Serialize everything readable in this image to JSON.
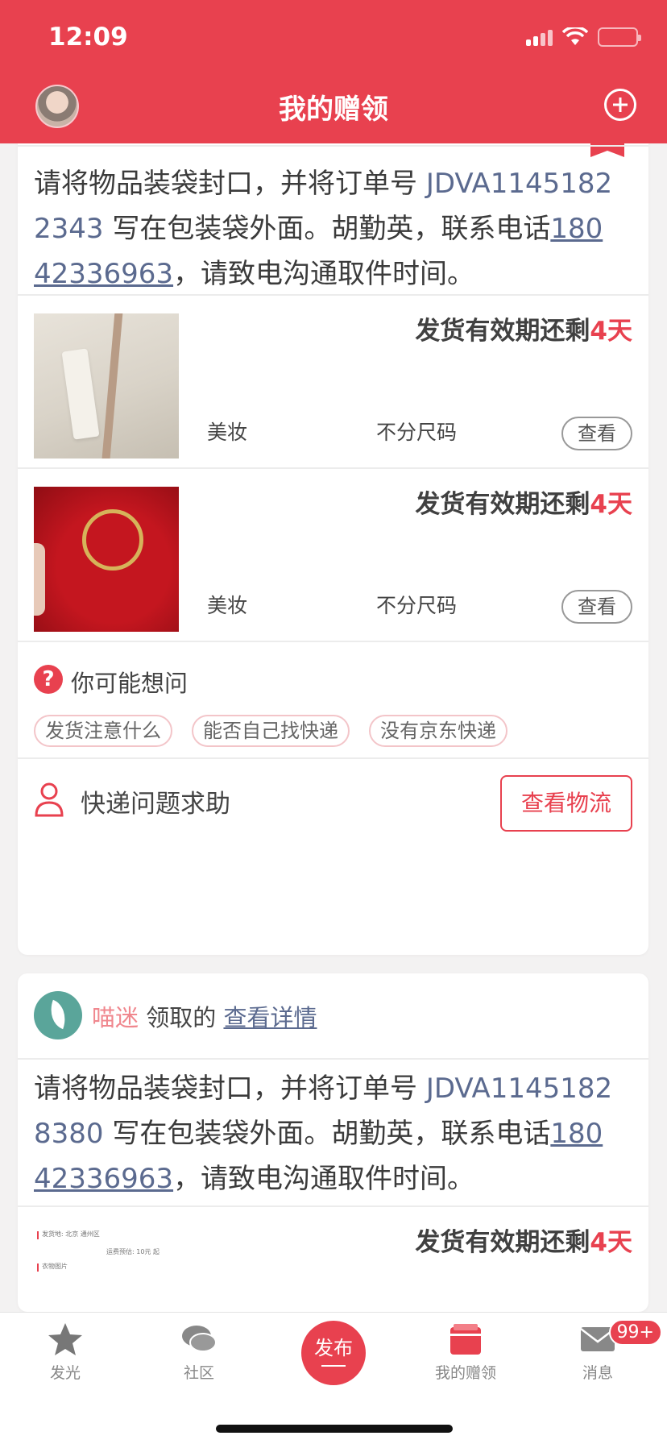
{
  "status_bar": {
    "time": "12:09"
  },
  "header": {
    "title": "我的赠领"
  },
  "card1": {
    "instruction": {
      "pre": "请将物品装袋封口，并将订单号 ",
      "order_line1": "JDVA1145182",
      "order_line2": "2343",
      "mid": " 写在包装袋外面。胡勤英，联系电话",
      "phone_line1": "180",
      "phone_line2": "42336963",
      "post": "，请致电沟通取件时间。"
    },
    "items": [
      {
        "deadline_prefix": "发货有效期还剩",
        "deadline_days": "4天",
        "category": "美妆",
        "size": "不分尺码",
        "view": "查看"
      },
      {
        "deadline_prefix": "发货有效期还剩",
        "deadline_days": "4天",
        "category": "美妆",
        "size": "不分尺码",
        "view": "查看"
      }
    ],
    "faq": {
      "title": "你可能想问",
      "chips": [
        "发货注意什么",
        "能否自己找快递",
        "没有京东快递"
      ]
    },
    "help": {
      "text": "快递问题求助",
      "button": "查看物流"
    }
  },
  "card2": {
    "claimer": {
      "name": "喵迷",
      "mid": " 领取的 ",
      "link": "查看详情"
    },
    "instruction": {
      "pre": "请将物品装袋封口，并将订单号 ",
      "order_line1": "JDVA1145182",
      "order_line2": "8380",
      "mid": " 写在包装袋外面。胡勤英，联系电话",
      "phone_line1": "180",
      "phone_line2": "42336963",
      "post": "，请致电沟通取件时间。"
    },
    "item": {
      "deadline_prefix": "发货有效期还剩",
      "deadline_days": "4天",
      "thumb_text": {
        "line1": "发货地: 北京 通州区",
        "line2": "运费预估: 10元 起",
        "line3": "衣物图片"
      }
    }
  },
  "tabbar": {
    "tabs": [
      {
        "label": "发光",
        "icon": "star-icon"
      },
      {
        "label": "社区",
        "icon": "chat-icon"
      },
      {
        "label": "发布",
        "icon": "publish-icon"
      },
      {
        "label": "我的赠领",
        "icon": "gift-box-icon"
      },
      {
        "label": "消息",
        "icon": "mail-icon"
      }
    ],
    "badge": "99+"
  },
  "colors": {
    "accent": "#e8414f",
    "link": "#5b6a8f"
  }
}
